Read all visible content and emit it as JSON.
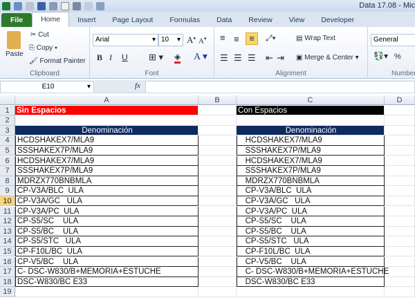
{
  "window": {
    "title": "Data 17.08 - Mic"
  },
  "tabs": [
    "File",
    "Home",
    "Insert",
    "Page Layout",
    "Formulas",
    "Data",
    "Review",
    "View",
    "Developer"
  ],
  "ribbon": {
    "clipboard": {
      "paste": "Paste",
      "cut": "Cut",
      "copy": "Copy",
      "format_painter": "Format Painter",
      "label": "Clipboard"
    },
    "font": {
      "name": "Arial",
      "size": "10",
      "bold": "B",
      "italic": "I",
      "underline": "U",
      "label": "Font"
    },
    "alignment": {
      "wrap_text": "Wrap Text",
      "merge_center": "Merge & Center",
      "label": "Alignment"
    },
    "number": {
      "format": "General",
      "percent": "%",
      "label": "Number"
    }
  },
  "formula_bar": {
    "name_box": "E10",
    "fx": "fx",
    "value": ""
  },
  "columns": [
    "A",
    "B",
    "C",
    "D"
  ],
  "rows": [
    "1",
    "2",
    "3",
    "4",
    "5",
    "6",
    "7",
    "8",
    "9",
    "10",
    "11",
    "12",
    "13",
    "14",
    "15",
    "16",
    "17",
    "18",
    "19"
  ],
  "sheet": {
    "a1": "Sin Espacios",
    "c1": "Con Espacios",
    "header": "Denominación",
    "col_a": [
      "HCDSHAKEX7/MLA9",
      "SSSHAKEX7P/MLA9",
      "HCDSHAKEX7/MLA9",
      "SSSHAKEX7P/MLA9",
      "MDRZX770BNBMLA",
      "CP-V3A/BLC  ULA",
      "CP-V3A/GC   ULA",
      "CP-V3A/PC  ULA",
      "CP-S5/SC    ULA",
      "CP-S5/BC    ULA",
      "CP-S5/STC   ULA",
      "CP-F10L/BC  ULA",
      "CP-V5/BC    ULA",
      "C- DSC-W830/B+MEMORIA+ESTUCHE",
      "DSC-W830/BC E33"
    ],
    "col_c": [
      "   HCDSHAKEX7/MLA9",
      "   SSSHAKEX7P/MLA9",
      "   HCDSHAKEX7/MLA9",
      "   SSSHAKEX7P/MLA9",
      "   MDRZX770BNBMLA",
      "   CP-V3A/BLC  ULA",
      "   CP-V3A/GC   ULA",
      "   CP-V3A/PC  ULA",
      "   CP-S5/SC    ULA",
      "   CP-S5/BC    ULA",
      "   CP-S5/STC   ULA",
      "   CP-F10L/BC  ULA",
      "   CP-V5/BC    ULA",
      "   C- DSC-W830/B+MEMORIA+ESTUCHE",
      "   DSC-W830/BC E33"
    ]
  },
  "colors": {
    "red": "#ff0000",
    "black": "#000000",
    "navy": "#0f2a5f"
  }
}
